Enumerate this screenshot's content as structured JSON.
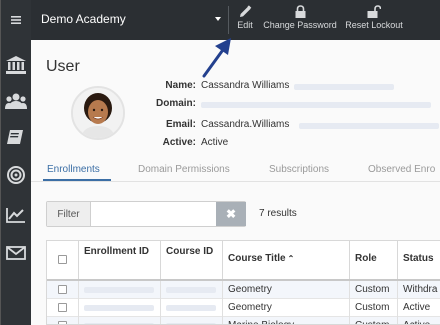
{
  "topbar": {
    "org_name": "Demo Academy",
    "tools": [
      {
        "label": "Edit",
        "icon": "pencil-icon"
      },
      {
        "label": "Change Password",
        "icon": "lock-icon"
      },
      {
        "label": "Reset Lockout",
        "icon": "unlock-icon"
      }
    ]
  },
  "sidebar": {
    "items": [
      {
        "icon": "menu-icon"
      },
      {
        "icon": "institution-icon"
      },
      {
        "icon": "users-icon"
      },
      {
        "icon": "book-icon"
      },
      {
        "icon": "target-icon"
      },
      {
        "icon": "chart-icon"
      },
      {
        "icon": "mail-icon"
      }
    ]
  },
  "page": {
    "title": "User",
    "fields": {
      "name_label": "Name:",
      "name_value": "Cassandra Williams",
      "domain_label": "Domain:",
      "domain_value": "",
      "email_label": "Email:",
      "email_value": "Cassandra.Williams",
      "active_label": "Active:",
      "active_value": "Active"
    }
  },
  "tabs": [
    {
      "label": "Enrollments",
      "active": true
    },
    {
      "label": "Domain Permissions",
      "active": false
    },
    {
      "label": "Subscriptions",
      "active": false
    },
    {
      "label": "Observed Enro",
      "active": false
    }
  ],
  "filter": {
    "label": "Filter",
    "value": "",
    "clear": "✖",
    "results": "7 results"
  },
  "table": {
    "columns": [
      "Enrollment ID",
      "Course ID",
      "Course Title",
      "Role",
      "Status"
    ],
    "sort_indicator": "⌃",
    "rows": [
      {
        "enrollment_id": "",
        "course_id": "",
        "course_title": "Geometry",
        "role": "Custom",
        "status": "Withdra"
      },
      {
        "enrollment_id": "",
        "course_id": "",
        "course_title": "Geometry",
        "role": "Custom",
        "status": "Active"
      },
      {
        "enrollment_id": "",
        "course_id": "",
        "course_title": "Marine Biology",
        "role": "Custom",
        "status": "Active"
      }
    ]
  },
  "colors": {
    "rail": "#2f3337",
    "topbar": "#2b2f33",
    "accent": "#3b6ea5",
    "arrow": "#23408e"
  }
}
